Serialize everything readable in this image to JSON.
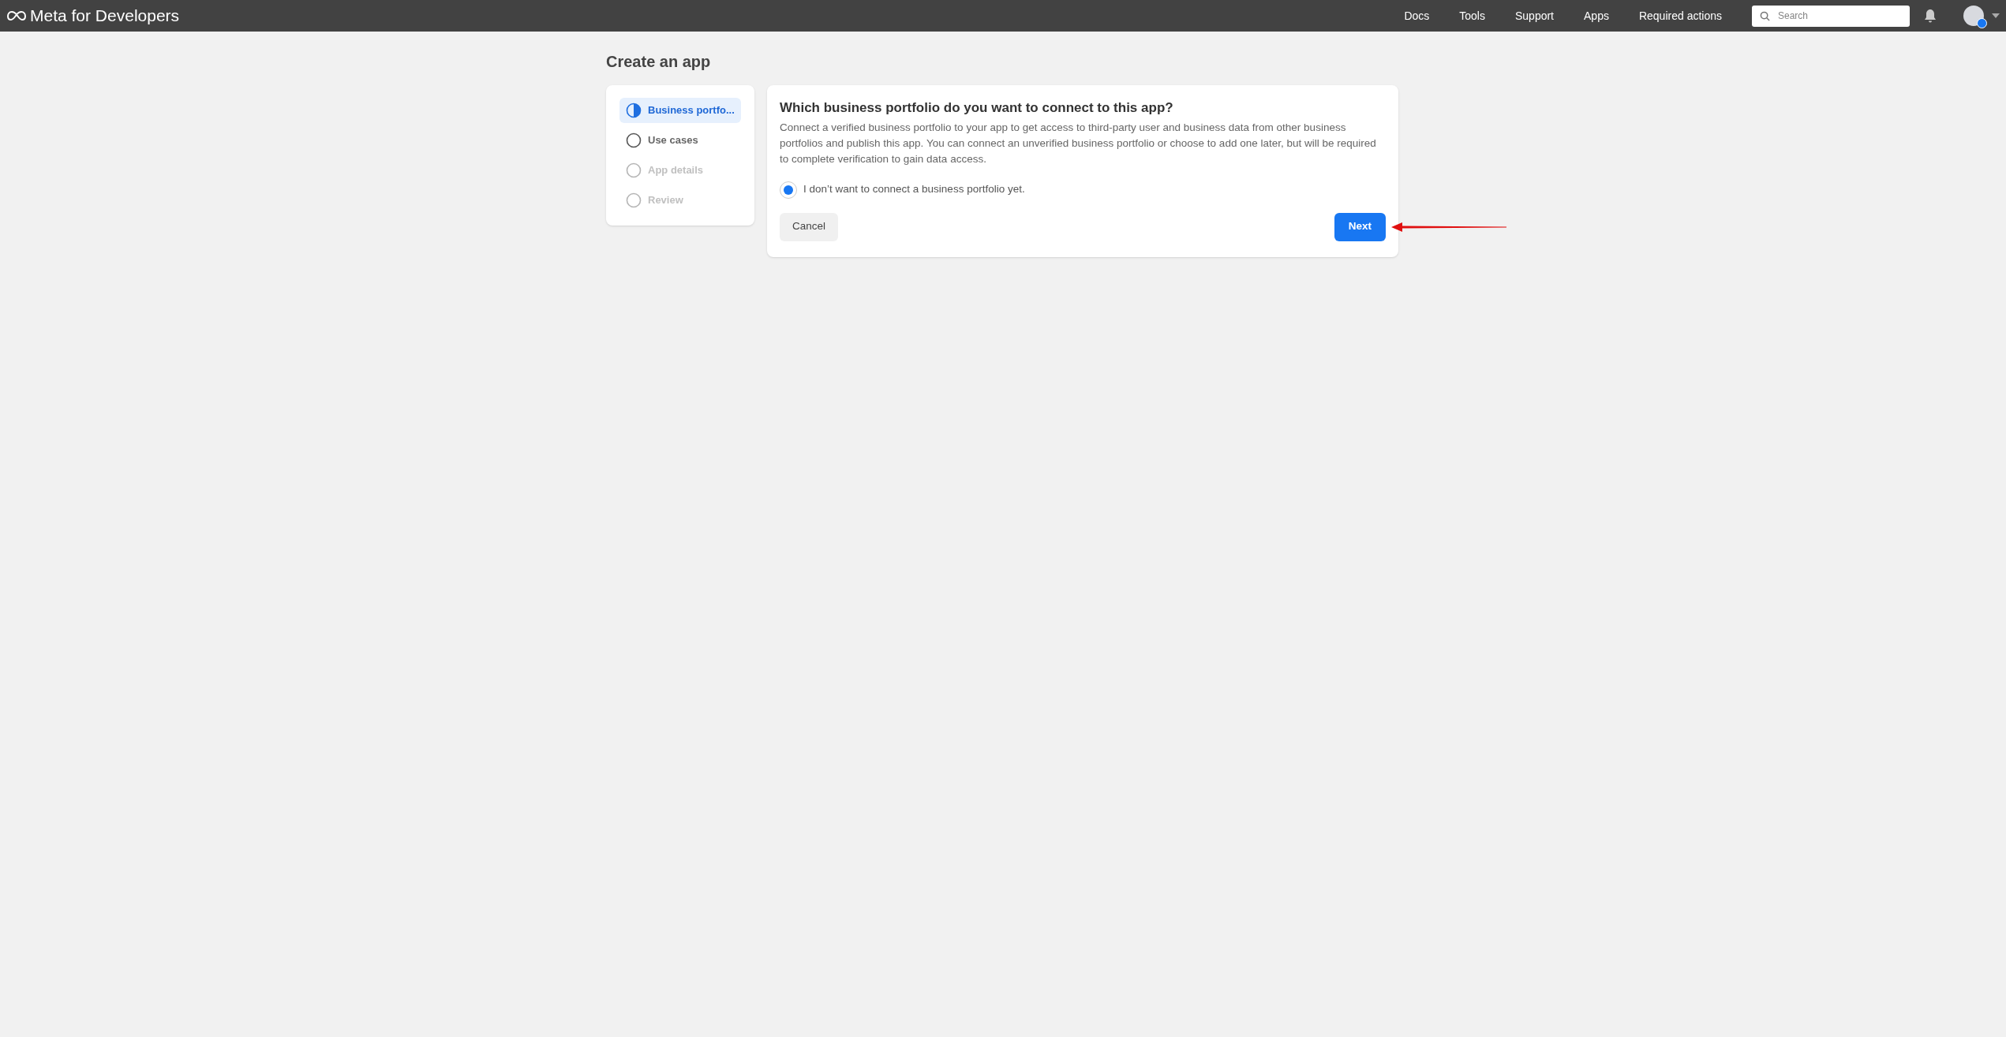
{
  "header": {
    "logo": "Meta for Developers",
    "nav": [
      "Docs",
      "Tools",
      "Support",
      "Apps",
      "Required actions"
    ],
    "search": {
      "placeholder": "Search"
    }
  },
  "page": {
    "title": "Create an app"
  },
  "steps": [
    {
      "label": "Business portfo...",
      "selected": true,
      "disabled": false
    },
    {
      "label": "Use cases",
      "selected": false,
      "disabled": false
    },
    {
      "label": "App details",
      "selected": false,
      "disabled": true
    },
    {
      "label": "Review",
      "selected": false,
      "disabled": true
    }
  ],
  "card": {
    "heading": "Which business portfolio do you want to connect to this app?",
    "description": "Connect a verified business portfolio to your app to get access to third-party user and business data from other business portfolios and publish this app. You can connect an unverified business portfolio or choose to add one later, but will be required to complete verification to gain data access.",
    "options": [
      {
        "label": "I don’t want to connect a business portfolio yet.",
        "selected": true
      }
    ],
    "buttons": [
      {
        "label": "Cancel",
        "kind": "secondary"
      },
      {
        "label": "Next",
        "kind": "primary"
      }
    ]
  }
}
